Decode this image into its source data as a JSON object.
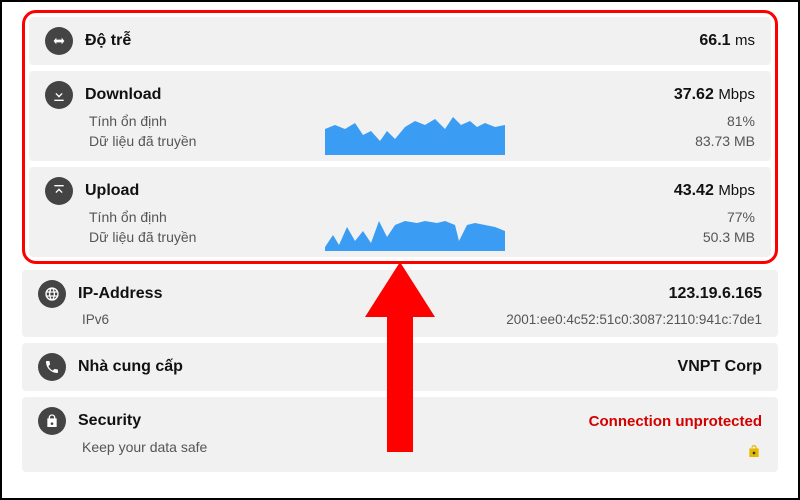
{
  "latency": {
    "label": "Độ trễ",
    "value": "66.1",
    "unit": "ms"
  },
  "download": {
    "label": "Download",
    "value": "37.62",
    "unit": "Mbps",
    "stability_label": "Tính ổn định",
    "stability_value": "81%",
    "data_label": "Dữ liệu đã truyền",
    "data_value": "83.73 MB"
  },
  "upload": {
    "label": "Upload",
    "value": "43.42",
    "unit": "Mbps",
    "stability_label": "Tính ổn định",
    "stability_value": "77%",
    "data_label": "Dữ liệu đã truyền",
    "data_value": "50.3 MB"
  },
  "ip": {
    "label": "IP-Address",
    "value": "123.19.6.165",
    "ipv6_label": "IPv6",
    "ipv6_value": "2001:ee0:4c52:51c0:3087:2110:941c:7de1"
  },
  "provider": {
    "label": "Nhà cung cấp",
    "value": "VNPT Corp"
  },
  "security": {
    "label": "Security",
    "sub_label": "Keep your data safe",
    "status": "Connection unprotected"
  }
}
